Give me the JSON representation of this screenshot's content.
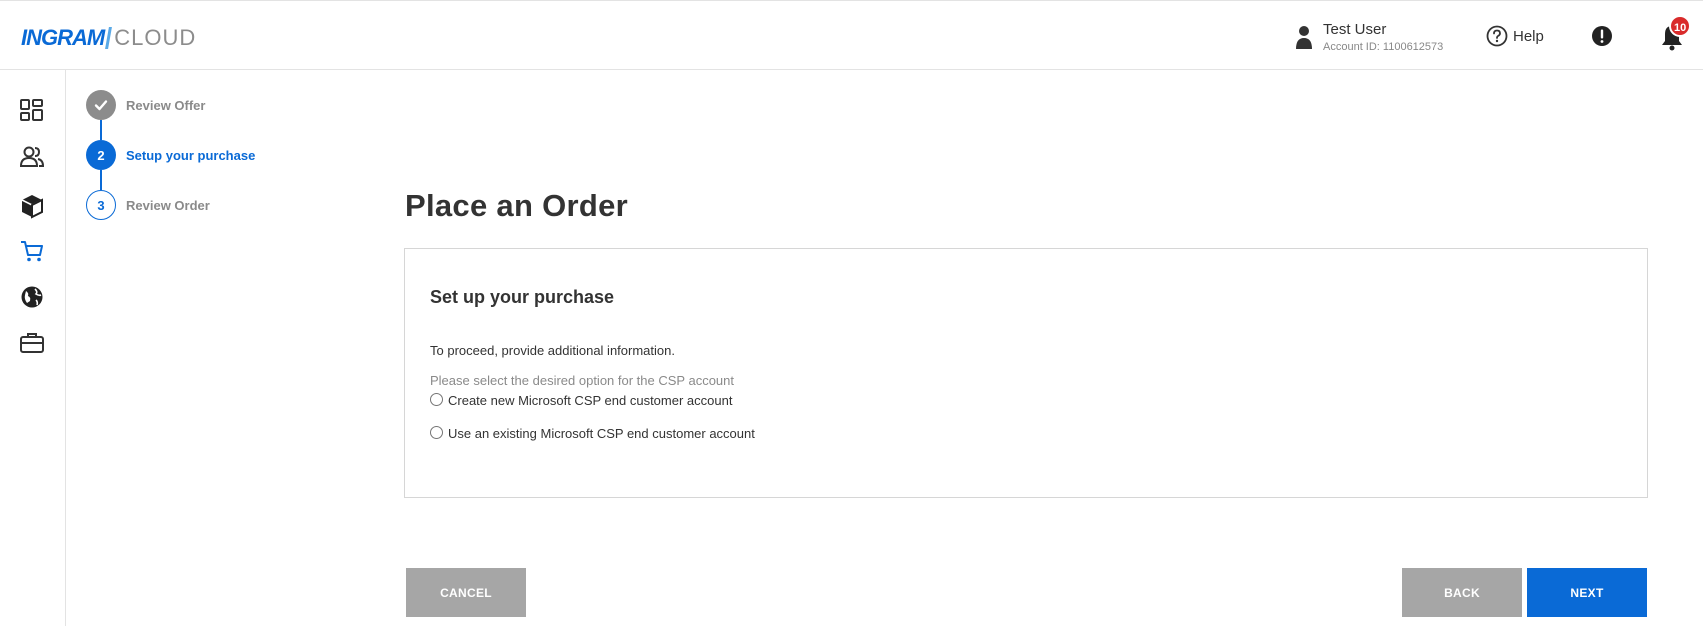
{
  "header": {
    "logo_ingram": "INGRAM",
    "logo_cloud": "CLOUD",
    "user_name": "Test User",
    "account_id": "Account ID: 1100612573",
    "help_label": "Help",
    "notification_count": "10"
  },
  "sidebar": {
    "items": [
      {
        "name": "dashboard",
        "icon": "dashboard-icon"
      },
      {
        "name": "customers",
        "icon": "users-icon"
      },
      {
        "name": "products",
        "icon": "box-icon"
      },
      {
        "name": "marketplace",
        "icon": "cart-icon",
        "active": true
      },
      {
        "name": "global",
        "icon": "globe-icon"
      },
      {
        "name": "business",
        "icon": "briefcase-icon"
      }
    ]
  },
  "stepper": {
    "steps": [
      {
        "number": "",
        "label": "Review Offer",
        "state": "completed"
      },
      {
        "number": "2",
        "label": "Setup your purchase",
        "state": "active"
      },
      {
        "number": "3",
        "label": "Review Order",
        "state": "pending"
      }
    ]
  },
  "main": {
    "title": "Place an Order",
    "card": {
      "title": "Set up your purchase",
      "intro": "To proceed, provide additional information.",
      "hint": "Please select the desired option for the CSP account",
      "options": [
        {
          "label": "Create new Microsoft CSP end customer account",
          "selected": false
        },
        {
          "label": "Use an existing Microsoft CSP end customer account",
          "selected": false
        }
      ]
    }
  },
  "actions": {
    "cancel": "CANCEL",
    "back": "BACK",
    "next": "NEXT"
  },
  "colors": {
    "accent": "#0a6ad6",
    "completed_step": "#8c8c8c",
    "disabled_button": "#a6a6a6",
    "badge": "#d92b2b"
  }
}
